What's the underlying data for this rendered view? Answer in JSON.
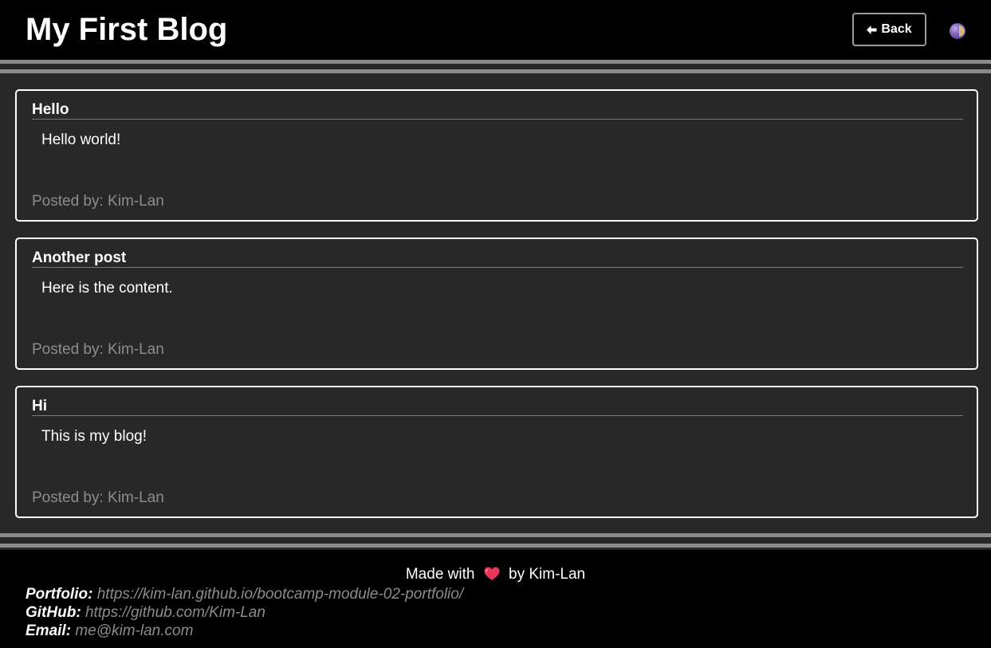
{
  "header": {
    "title": "My First Blog",
    "back_label": "Back",
    "back_icon": "arrow-left-icon",
    "theme_icon": "theme-toggle-icon"
  },
  "posts": [
    {
      "title": "Hello",
      "content": "Hello world!",
      "author": "Posted by: Kim-Lan"
    },
    {
      "title": "Another post",
      "content": "Here is the content.",
      "author": "Posted by: Kim-Lan"
    },
    {
      "title": "Hi",
      "content": "This is my blog!",
      "author": "Posted by: Kim-Lan"
    }
  ],
  "footer": {
    "made_with_prefix": "Made with",
    "made_with_suffix": "by Kim-Lan",
    "heart_icon": "heart-icon",
    "portfolio_label": "Portfolio:",
    "portfolio_url": "https://kim-lan.github.io/bootcamp-module-02-portfolio/",
    "github_label": "GitHub:",
    "github_url": "https://github.com/Kim-Lan",
    "email_label": "Email:",
    "email_address": "me@kim-lan.com"
  },
  "colors": {
    "background": "#282828",
    "header_bg": "#000000",
    "muted_text": "#8c8c8c",
    "divider": "#8a8a8a",
    "heart": "#e8365d"
  }
}
